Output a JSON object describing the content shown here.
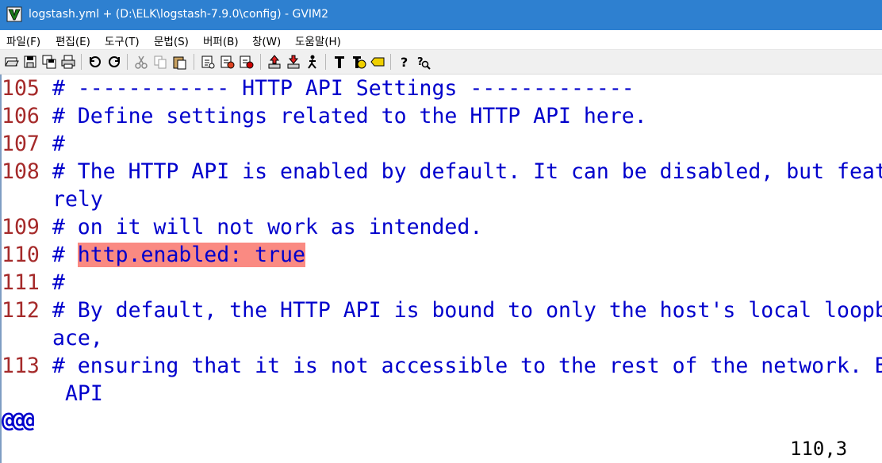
{
  "window": {
    "title": "logstash.yml + (D:\\ELK\\logstash-7.9.0\\config) - GVIM2"
  },
  "menu": [
    {
      "label": "파일(F)"
    },
    {
      "label": "편집(E)"
    },
    {
      "label": "도구(T)"
    },
    {
      "label": "문법(S)"
    },
    {
      "label": "버퍼(B)"
    },
    {
      "label": "창(W)"
    },
    {
      "label": "도움말(H)"
    }
  ],
  "toolbar": [
    {
      "icon": "open-icon"
    },
    {
      "icon": "save-icon"
    },
    {
      "icon": "save-all-icon"
    },
    {
      "icon": "print-icon"
    },
    {
      "icon": "undo-icon"
    },
    {
      "icon": "redo-icon"
    },
    {
      "icon": "cut-icon"
    },
    {
      "icon": "copy-icon"
    },
    {
      "icon": "paste-icon"
    },
    {
      "icon": "load-session-icon"
    },
    {
      "icon": "save-session-icon"
    },
    {
      "icon": "run-script-icon"
    },
    {
      "icon": "make-icon"
    },
    {
      "icon": "shell-icon"
    },
    {
      "icon": "run-ctags-icon"
    },
    {
      "icon": "tag-jump-icon"
    },
    {
      "icon": "tag-back-icon"
    },
    {
      "icon": "tag-label-icon"
    },
    {
      "icon": "help-icon"
    },
    {
      "icon": "find-help-icon"
    }
  ],
  "editor": {
    "lines": [
      {
        "num": "105",
        "text": "# ------------ HTTP API Settings -------------"
      },
      {
        "num": "106",
        "text": "# Define settings related to the HTTP API here."
      },
      {
        "num": "107",
        "text": "#"
      },
      {
        "num": "108",
        "text": "# The HTTP API is enabled by default. It can be disabled, but feat"
      },
      {
        "num": "",
        "text": "rely"
      },
      {
        "num": "109",
        "text": "# on it will not work as intended."
      },
      {
        "num": "110",
        "prefix": "# ",
        "highlight": "http.enabled: true"
      },
      {
        "num": "111",
        "text": "#"
      },
      {
        "num": "112",
        "text": "# By default, the HTTP API is bound to only the host's local loopb"
      },
      {
        "num": "",
        "text": "ace,"
      },
      {
        "num": "113",
        "text": "# ensuring that it is not accessible to the rest of the network. B"
      },
      {
        "num": "",
        "text": " API"
      }
    ],
    "last_line_marker": "@@@",
    "ruler": "110,3",
    "colors": {
      "line_number": "#a52a2a",
      "comment": "#0000cc",
      "highlight": "#fa8a82"
    }
  }
}
